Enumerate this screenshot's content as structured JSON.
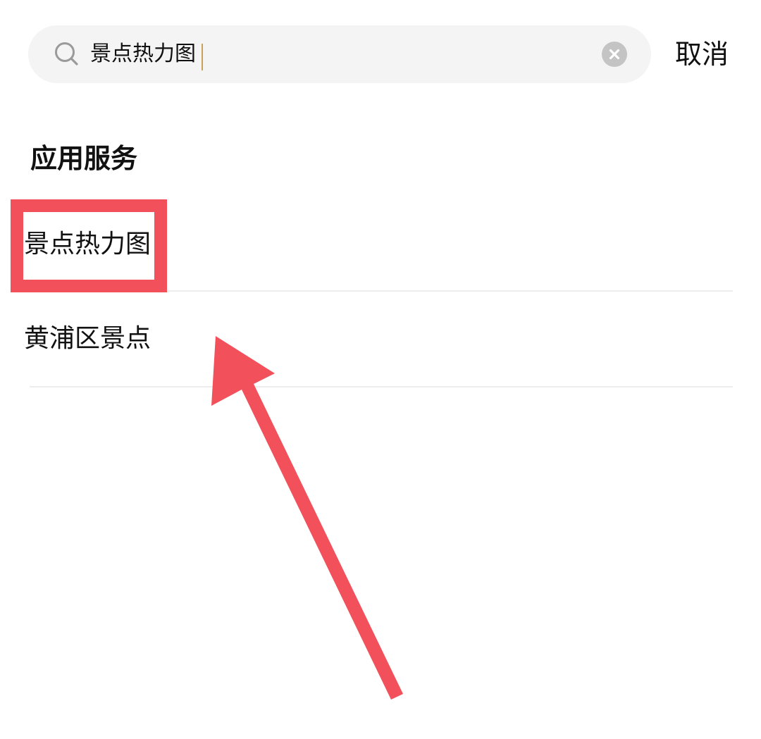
{
  "search": {
    "query": "景点热力图",
    "icon": "search-icon",
    "clear_icon": "clear-icon"
  },
  "cancel_label": "取消",
  "section": {
    "title": "应用服务"
  },
  "results": [
    {
      "label": "景点热力图"
    },
    {
      "label": "黄浦区景点"
    }
  ],
  "colors": {
    "annotation": "#f2515c",
    "search_background": "#f4f4f4",
    "caret": "#c8a15a"
  }
}
